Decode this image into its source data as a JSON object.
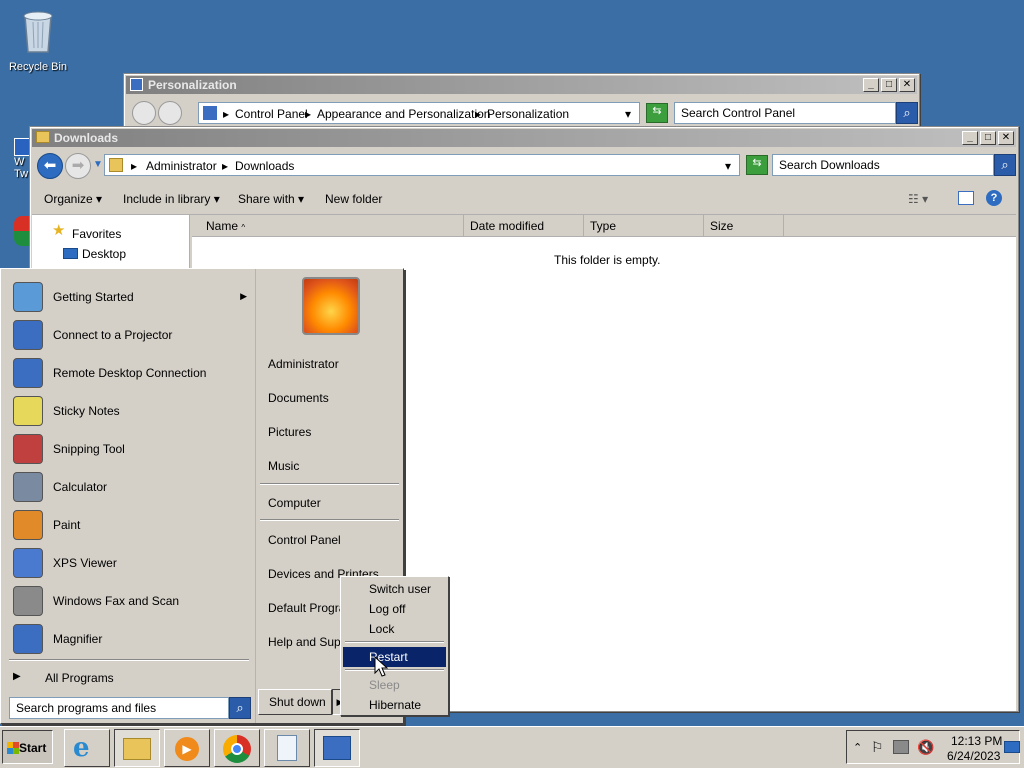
{
  "desktop": {
    "recycle_bin": "Recycle Bin",
    "partial_icon_label": "W\nTw"
  },
  "personalization_window": {
    "title": "Personalization",
    "breadcrumbs": [
      "Control Panel",
      "Appearance and Personalization",
      "Personalization"
    ],
    "search_placeholder": "Search Control Panel"
  },
  "downloads_window": {
    "title": "Downloads",
    "breadcrumbs": [
      "Administrator",
      "Downloads"
    ],
    "search_placeholder": "Search Downloads",
    "toolbar": {
      "organize": "Organize",
      "include_in_library": "Include in library",
      "share_with": "Share with",
      "new_folder": "New folder"
    },
    "nav": {
      "favorites": "Favorites",
      "desktop": "Desktop"
    },
    "columns": [
      "Name",
      "Date modified",
      "Type",
      "Size"
    ],
    "empty_text": "This folder is empty."
  },
  "start_menu": {
    "programs": [
      {
        "label": "Getting Started",
        "icon": "getting-started-icon",
        "has_submenu": true
      },
      {
        "label": "Connect to a Projector",
        "icon": "projector-icon"
      },
      {
        "label": "Remote Desktop Connection",
        "icon": "remote-desktop-icon"
      },
      {
        "label": "Sticky Notes",
        "icon": "sticky-notes-icon"
      },
      {
        "label": "Snipping Tool",
        "icon": "snipping-tool-icon"
      },
      {
        "label": "Calculator",
        "icon": "calculator-icon"
      },
      {
        "label": "Paint",
        "icon": "paint-icon"
      },
      {
        "label": "XPS Viewer",
        "icon": "xps-viewer-icon"
      },
      {
        "label": "Windows Fax and Scan",
        "icon": "fax-scan-icon"
      },
      {
        "label": "Magnifier",
        "icon": "magnifier-icon"
      }
    ],
    "all_programs": "All Programs",
    "search_placeholder": "Search programs and files",
    "right_links": {
      "user": "Administrator",
      "documents": "Documents",
      "pictures": "Pictures",
      "music": "Music",
      "computer": "Computer",
      "control_panel": "Control Panel",
      "devices": "Devices and Printers",
      "default_programs": "Default Programs",
      "help": "Help and Support"
    },
    "shutdown": "Shut down"
  },
  "power_menu": {
    "items": [
      "Switch user",
      "Log off",
      "Lock",
      "Restart",
      "Sleep",
      "Hibernate"
    ],
    "selected": "Restart",
    "disabled": "Sleep"
  },
  "taskbar": {
    "start": "Start",
    "clock_time": "12:13 PM",
    "clock_date": "6/24/2023"
  }
}
